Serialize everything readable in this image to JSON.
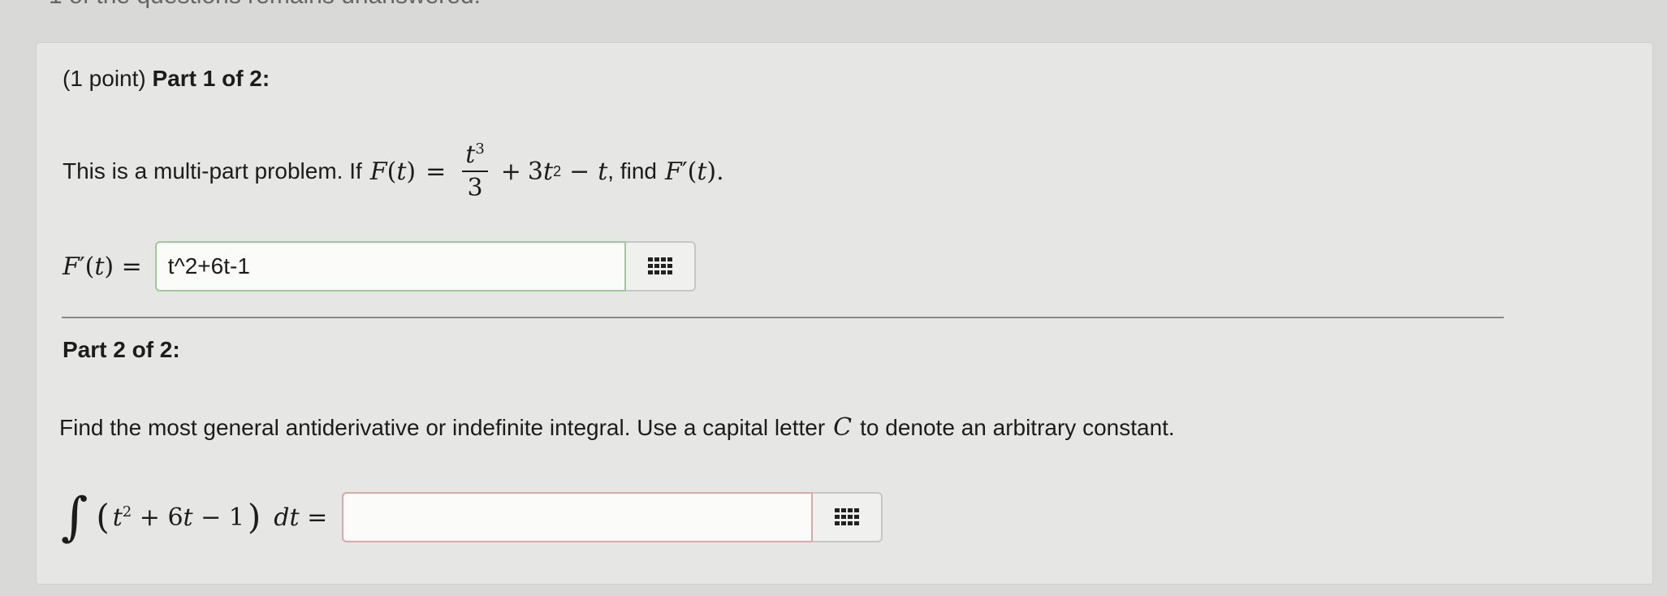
{
  "top_note": "1 of the questions remains unanswered.",
  "part1": {
    "points": "(1 point)",
    "title": "Part 1 of 2:",
    "intro": "This is a multi-part problem. If",
    "after": ", find",
    "answer_label": "F′(t) =",
    "answer_value": "t^2+6t-1"
  },
  "part2": {
    "title": "Part 2 of 2:",
    "instruction_a": "Find the most general antiderivative or indefinite integral. Use a capital letter",
    "instruction_b": "to denote an arbitrary constant.",
    "letter": "C",
    "answer_value": ""
  },
  "icons": {
    "matrix": "keypad-grid-icon"
  }
}
